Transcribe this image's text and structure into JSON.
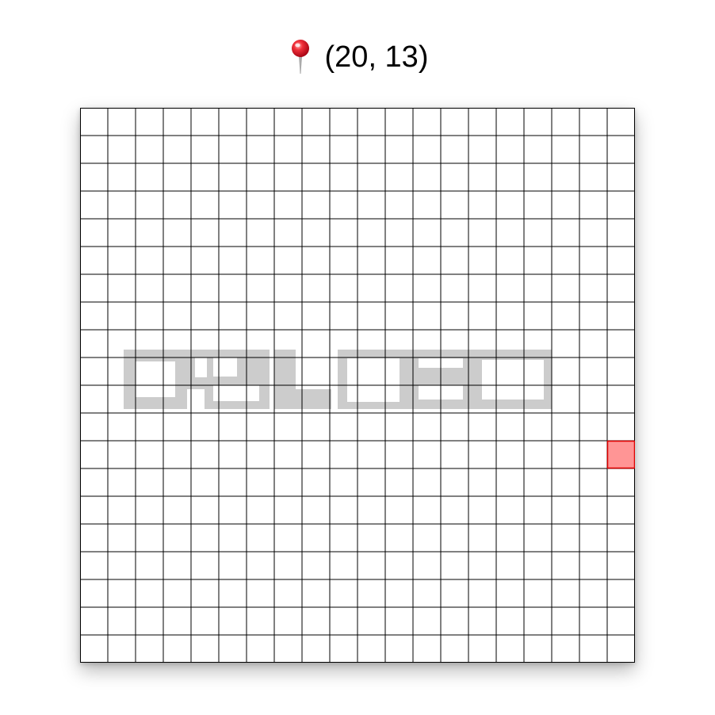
{
  "header": {
    "pin_icon": "round-pushpin-icon",
    "coordinates_text": "(20, 13)"
  },
  "board": {
    "columns": 20,
    "rows": 20,
    "grid_color": "#000000",
    "cell_color": "#ffffff",
    "selected_cell": {
      "col": 20,
      "row": 13,
      "fill": "#ff9595",
      "stroke": "#e00000"
    },
    "watermark": {
      "text": "PBLGEN",
      "color": "#cccccc"
    }
  }
}
